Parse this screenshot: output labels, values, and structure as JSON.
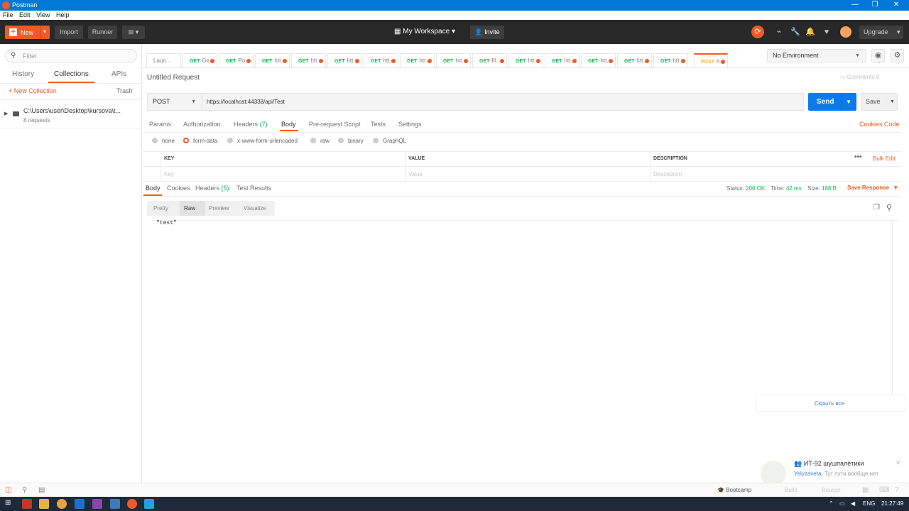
{
  "window": {
    "title": "Postman",
    "controls": [
      "—",
      "❐",
      "✕"
    ]
  },
  "menu": [
    "File",
    "Edit",
    "View",
    "Help"
  ],
  "header": {
    "new_label": "New",
    "import_label": "Import",
    "runner_label": "Runner",
    "workspace_label": "My Workspace",
    "invite_label": "Invite",
    "upgrade_label": "Upgrade"
  },
  "sidebar": {
    "filter_placeholder": "Filter",
    "tabs": [
      "History",
      "Collections",
      "APIs"
    ],
    "active_tab": "Collections",
    "new_collection_label": "New Collection",
    "trash_label": "Trash",
    "collection": {
      "name": "C:\\Users\\user\\Desktop\\kursova\\t...",
      "subtitle": "8 requests"
    }
  },
  "request_tabs": [
    {
      "method": "",
      "label": "Laun..."
    },
    {
      "method": "GET",
      "label": "Ge..."
    },
    {
      "method": "GET",
      "label": "Po..."
    },
    {
      "method": "GET",
      "label": "htt..."
    },
    {
      "method": "GET",
      "label": "htt..."
    },
    {
      "method": "GET",
      "label": "htt..."
    },
    {
      "method": "GET",
      "label": "htt..."
    },
    {
      "method": "GET",
      "label": "htt..."
    },
    {
      "method": "GET",
      "label": "htt..."
    },
    {
      "method": "GET",
      "label": "fil..."
    },
    {
      "method": "GET",
      "label": "htt..."
    },
    {
      "method": "GET",
      "label": "htt..."
    },
    {
      "method": "GET",
      "label": "htt..."
    },
    {
      "method": "GET",
      "label": "htt..."
    },
    {
      "method": "GET",
      "label": "htt..."
    },
    {
      "method": "POST",
      "label": "h..."
    }
  ],
  "environment": {
    "selected": "No Environment"
  },
  "request": {
    "name": "Untitled Request",
    "comments_label": "Comments",
    "comments_count": "0",
    "method": "POST",
    "url": "https://localhost:44338/api/Test",
    "send_label": "Send",
    "save_label": "Save",
    "tabs": {
      "params": "Params",
      "authorization": "Authorization",
      "headers": "Headers",
      "headers_count": "(7)",
      "body": "Body",
      "prerequest": "Pre-request Script",
      "tests": "Tests",
      "settings": "Settings"
    },
    "cookies_label": "Cookies",
    "code_label": "Code",
    "body_types": [
      "none",
      "form-data",
      "x-www-form-urlencoded",
      "raw",
      "binary",
      "GraphQL"
    ],
    "selected_body_type": "form-data",
    "table": {
      "key_header": "KEY",
      "value_header": "VALUE",
      "description_header": "DESCRIPTION",
      "bulk_edit": "Bulk Edit",
      "key_placeholder": "Key",
      "value_placeholder": "Value",
      "description_placeholder": "Description"
    }
  },
  "response": {
    "tabs": {
      "body": "Body",
      "cookies": "Cookies",
      "headers": "Headers",
      "headers_count": "(5)",
      "test_results": "Test Results"
    },
    "status_label": "Status:",
    "status_value": "200 OK",
    "time_label": "Time:",
    "time_value": "42 ms",
    "size_label": "Size:",
    "size_value": "188 B",
    "save_response_label": "Save Response",
    "formats": [
      "Pretty",
      "Raw",
      "Preview",
      "Visualize"
    ],
    "active_format": "Raw",
    "body_text": "\"test\""
  },
  "notifications": {
    "hide_all": "Скрыть все",
    "chat_title": "ИТ-92 шушпалётики",
    "chat_sender": "Yelyzaveta:",
    "chat_message": "Тут пути вообще нет"
  },
  "statusbar": {
    "bootcamp": "Bootcamp",
    "build": "Build",
    "browse": "Browse"
  },
  "taskbar": {
    "language": "ENG",
    "time": "21:27:49"
  },
  "colors": {
    "accent": "#ef5b25",
    "send": "#097bed",
    "success": "#0cbb52",
    "titlebar": "#0078d7",
    "header": "#282828"
  }
}
